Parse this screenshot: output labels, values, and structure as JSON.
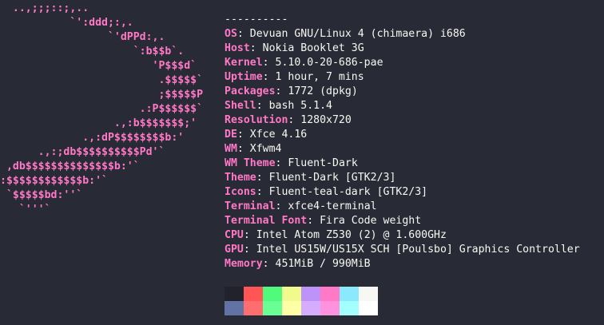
{
  "logo": {
    "lines": [
      "  ..,;;;::;,..",
      "           `':ddd;:,.",
      "                 `'dPPd:,.",
      "                     `:b$$b`.",
      "                        'P$$$d`",
      "                         .$$$$$`",
      "                         ;$$$$$P",
      "                      .:P$$$$$$`",
      "                  .,:b$$$$$$$;'",
      "             .,:dP$$$$$$$$b:'",
      "      .,:;db$$$$$$$$$$Pd'`",
      " ,db$$$$$$$$$$$$$$b:'`",
      ":$$$$$$$$$$$$b:'`",
      " `$$$$$bd:''`",
      "   `'''`"
    ]
  },
  "header": {
    "separator": "----------"
  },
  "info": [
    {
      "key": "OS",
      "value": "Devuan GNU/Linux 4 (chimaera) i686"
    },
    {
      "key": "Host",
      "value": "Nokia Booklet 3G"
    },
    {
      "key": "Kernel",
      "value": "5.10.0-20-686-pae"
    },
    {
      "key": "Uptime",
      "value": "1 hour, 7 mins"
    },
    {
      "key": "Packages",
      "value": "1772 (dpkg)"
    },
    {
      "key": "Shell",
      "value": "bash 5.1.4"
    },
    {
      "key": "Resolution",
      "value": "1280x720"
    },
    {
      "key": "DE",
      "value": "Xfce 4.16"
    },
    {
      "key": "WM",
      "value": "Xfwm4"
    },
    {
      "key": "WM Theme",
      "value": "Fluent-Dark"
    },
    {
      "key": "Theme",
      "value": "Fluent-Dark [GTK2/3]"
    },
    {
      "key": "Icons",
      "value": "Fluent-teal-dark [GTK2/3]"
    },
    {
      "key": "Terminal",
      "value": "xfce4-terminal"
    },
    {
      "key": "Terminal Font",
      "value": "Fira Code weight"
    },
    {
      "key": "CPU",
      "value": "Intel Atom Z530 (2) @ 1.600GHz"
    },
    {
      "key": "GPU",
      "value": "Intel US15W/US15X SCH [Poulsbo] Graphics Controller"
    },
    {
      "key": "Memory",
      "value": "451MiB / 990MiB"
    }
  ],
  "separator_char": ": ",
  "palette": {
    "normal": [
      "#21222c",
      "#ff5555",
      "#50fa7b",
      "#f1fa8c",
      "#bd93f9",
      "#ff79c6",
      "#8be9fd",
      "#f8f8f2"
    ],
    "bright": [
      "#6272a4",
      "#ff6e6e",
      "#69ff94",
      "#ffffa5",
      "#d6acff",
      "#ff92df",
      "#a4ffff",
      "#ffffff"
    ]
  },
  "colors": {
    "background": "#282a36",
    "foreground": "#f8f8f2",
    "accent": "#ff79c6"
  }
}
